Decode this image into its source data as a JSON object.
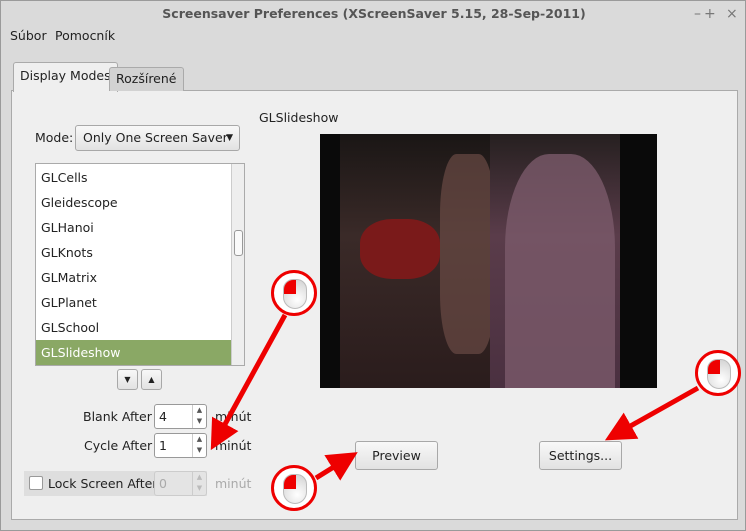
{
  "window": {
    "title": "Screensaver Preferences  (XScreenSaver 5.15, 28-Sep-2011)",
    "controls": [
      "–",
      "+",
      "×"
    ]
  },
  "menu": [
    "Súbor",
    "Pomocník"
  ],
  "tabs": [
    {
      "label": "Display Modes",
      "active": true
    },
    {
      "label": "Rozšírené",
      "active": false
    }
  ],
  "mode": {
    "label": "Mode:",
    "value": "Only One Screen Saver"
  },
  "list": {
    "items": [
      "GLCells",
      "Gleidescope",
      "GLHanoi",
      "GLKnots",
      "GLMatrix",
      "GLPlanet",
      "GLSchool",
      "GLSlideshow"
    ],
    "selected": "GLSlideshow",
    "selected_color": "#8aa865"
  },
  "timing": {
    "blank_label": "Blank After",
    "blank_value": "4",
    "cycle_label": "Cycle After",
    "cycle_value": "1",
    "lock_label": "Lock Screen After",
    "lock_value": "0",
    "lock_checked": false,
    "unit": "minút"
  },
  "preview": {
    "title": "GLSlideshow",
    "preview_button": "Preview",
    "settings_button": "Settings..."
  },
  "annotations": {
    "color": "#e00000",
    "icon": "mouse-left-click-icon"
  }
}
